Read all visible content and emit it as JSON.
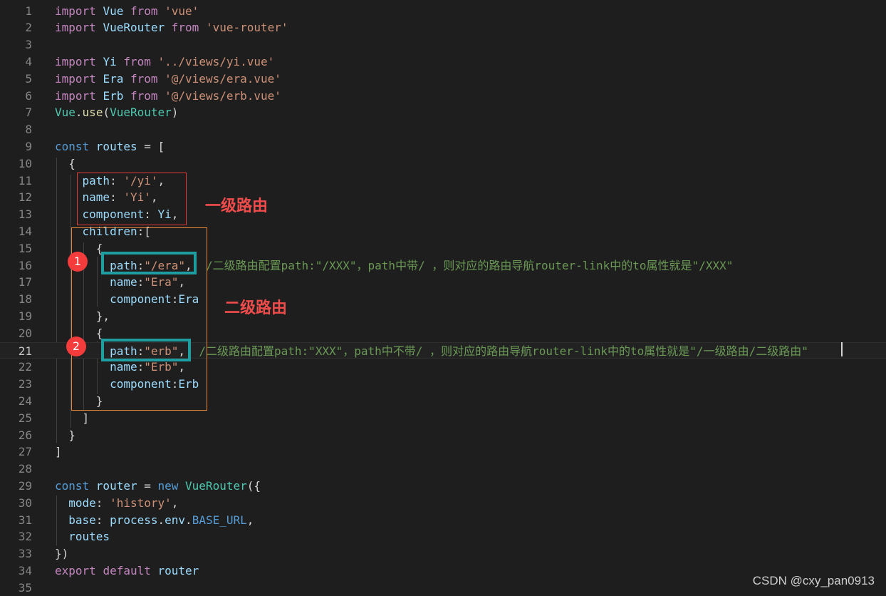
{
  "lines": [
    [
      [
        "import ",
        "kw2"
      ],
      [
        "Vue ",
        "var"
      ],
      [
        "from ",
        "kw2"
      ],
      [
        "'vue'",
        "str"
      ]
    ],
    [
      [
        "import ",
        "kw2"
      ],
      [
        "VueRouter ",
        "var"
      ],
      [
        "from ",
        "kw2"
      ],
      [
        "'vue-router'",
        "str"
      ]
    ],
    [],
    [
      [
        "import ",
        "kw2"
      ],
      [
        "Yi ",
        "var"
      ],
      [
        "from ",
        "kw2"
      ],
      [
        "'../views/yi.vue'",
        "str"
      ]
    ],
    [
      [
        "import ",
        "kw2"
      ],
      [
        "Era ",
        "var"
      ],
      [
        "from ",
        "kw2"
      ],
      [
        "'@/views/era.vue'",
        "str"
      ]
    ],
    [
      [
        "import ",
        "kw2"
      ],
      [
        "Erb ",
        "var"
      ],
      [
        "from ",
        "kw2"
      ],
      [
        "'@/views/erb.vue'",
        "str"
      ]
    ],
    [
      [
        "Vue",
        "cls"
      ],
      [
        ".",
        "pl"
      ],
      [
        "use",
        "fn"
      ],
      [
        "(",
        "pl"
      ],
      [
        "VueRouter",
        "cls"
      ],
      [
        ")",
        "pl"
      ]
    ],
    [],
    [
      [
        "const ",
        "kw"
      ],
      [
        "routes ",
        "var"
      ],
      [
        "= [",
        "pl"
      ]
    ],
    [
      [
        "  {",
        "pl"
      ]
    ],
    [
      [
        "    path",
        "var"
      ],
      [
        ": ",
        "pl"
      ],
      [
        "'/yi'",
        "str"
      ],
      [
        ",",
        "pl"
      ]
    ],
    [
      [
        "    name",
        "var"
      ],
      [
        ": ",
        "pl"
      ],
      [
        "'Yi'",
        "str"
      ],
      [
        ",",
        "pl"
      ]
    ],
    [
      [
        "    component",
        "var"
      ],
      [
        ": ",
        "pl"
      ],
      [
        "Yi",
        "var"
      ],
      [
        ",",
        "pl"
      ]
    ],
    [
      [
        "    children",
        "var"
      ],
      [
        ":[",
        "pl"
      ]
    ],
    [
      [
        "      {",
        "pl"
      ]
    ],
    [
      [
        "        path",
        "var"
      ],
      [
        ":",
        "pl"
      ],
      [
        "\"/era\"",
        "str"
      ],
      [
        ",  ",
        "pl"
      ],
      [
        "/二级路由配置path:\"/XXX\"，path中带/ ，则对应的路由导航router-link中的to属性就是\"/XXX\"",
        "cmt"
      ]
    ],
    [
      [
        "        name",
        "var"
      ],
      [
        ":",
        "pl"
      ],
      [
        "\"Era\"",
        "str"
      ],
      [
        ",",
        "pl"
      ]
    ],
    [
      [
        "        component",
        "var"
      ],
      [
        ":",
        "pl"
      ],
      [
        "Era",
        "var"
      ]
    ],
    [
      [
        "      },",
        "pl"
      ]
    ],
    [
      [
        "      {",
        "pl"
      ]
    ],
    [
      [
        "        path",
        "var"
      ],
      [
        ":",
        "pl"
      ],
      [
        "\"erb\"",
        "str"
      ],
      [
        ",  ",
        "pl"
      ],
      [
        "/二级路由配置path:\"XXX\"，path中不带/ ，则对应的路由导航router-link中的to属性就是\"/一级路由/二级路由\"",
        "cmt"
      ]
    ],
    [
      [
        "        name",
        "var"
      ],
      [
        ":",
        "pl"
      ],
      [
        "\"Erb\"",
        "str"
      ],
      [
        ",",
        "pl"
      ]
    ],
    [
      [
        "        component",
        "var"
      ],
      [
        ":",
        "pl"
      ],
      [
        "Erb",
        "var"
      ]
    ],
    [
      [
        "      }",
        "pl"
      ]
    ],
    [
      [
        "    ]",
        "pl"
      ]
    ],
    [
      [
        "  }",
        "pl"
      ]
    ],
    [
      [
        "]",
        "pl"
      ]
    ],
    [],
    [
      [
        "const ",
        "kw"
      ],
      [
        "router ",
        "var"
      ],
      [
        "= ",
        "pl"
      ],
      [
        "new ",
        "kw"
      ],
      [
        "VueRouter",
        "cls"
      ],
      [
        "({",
        "pl"
      ]
    ],
    [
      [
        "  mode",
        "var"
      ],
      [
        ": ",
        "pl"
      ],
      [
        "'history'",
        "str"
      ],
      [
        ",",
        "pl"
      ]
    ],
    [
      [
        "  base",
        "var"
      ],
      [
        ": ",
        "pl"
      ],
      [
        "process",
        "var"
      ],
      [
        ".",
        "pl"
      ],
      [
        "env",
        "var"
      ],
      [
        ".",
        "pl"
      ],
      [
        "BASE_URL",
        "kw"
      ],
      [
        ",",
        "pl"
      ]
    ],
    [
      [
        "  routes",
        "var"
      ]
    ],
    [
      [
        "})",
        "pl"
      ]
    ],
    [
      [
        "export ",
        "kw2"
      ],
      [
        "default ",
        "kw2"
      ],
      [
        "router",
        "var"
      ]
    ],
    []
  ],
  "current_line": 21,
  "annotations": {
    "level1_label": "一级路由",
    "level2_label": "二级路由",
    "badge1": "1",
    "badge2": "2",
    "colors": {
      "red_box": "#e53935",
      "orange_box": "#e8883a",
      "teal_box": "#1e9ea0",
      "badge": "#f53c3c"
    }
  },
  "watermark": "CSDN @cxy_pan0913"
}
